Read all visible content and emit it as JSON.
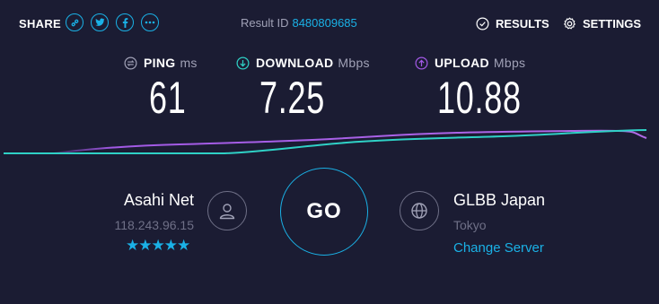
{
  "header": {
    "share_label": "SHARE",
    "share_icons": [
      "link-icon",
      "twitter-icon",
      "facebook-icon",
      "more-icon"
    ],
    "result_label": "Result ID",
    "result_id": "8480809685",
    "results_label": "RESULTS",
    "settings_label": "SETTINGS"
  },
  "metrics": {
    "ping": {
      "label": "PING",
      "unit": "ms",
      "value": "61"
    },
    "download": {
      "label": "DOWNLOAD",
      "unit": "Mbps",
      "value": "7.25"
    },
    "upload": {
      "label": "UPLOAD",
      "unit": "Mbps",
      "value": "10.88"
    }
  },
  "isp": {
    "name": "Asahi Net",
    "ip": "118.243.96.15",
    "rating": "★★★★★"
  },
  "go_label": "GO",
  "server": {
    "name": "GLBB Japan",
    "location": "Tokyo",
    "change_label": "Change Server"
  },
  "colors": {
    "background": "#1b1c33",
    "accent": "#1ab1e6",
    "download": "#2fd1c6",
    "upload": "#a259e6",
    "muted": "#6f7087"
  }
}
